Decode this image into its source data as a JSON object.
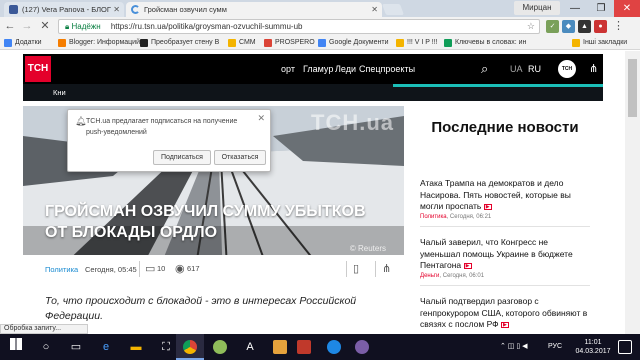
{
  "browser": {
    "tabs": [
      {
        "label": "(127) Vera Panova - БЛОГ",
        "favicon_color": "#3b5998"
      },
      {
        "label": "Гройсман озвучил сумм",
        "favicon_color": "#4a90d9"
      }
    ],
    "profile_name": "Мирцан",
    "window_controls": {
      "minimize": "—",
      "maximize": "❐",
      "close": "✕"
    },
    "omnibox": {
      "secure_label": "Надёжн",
      "url": "https://ru.tsn.ua/politika/groysman-ozvuchil-summu-ub"
    },
    "bookmarks": [
      {
        "label": "Додатки",
        "color": "#4285f4"
      },
      {
        "label": "Blogger: Информаций",
        "color": "#f57d00"
      },
      {
        "label": "Преобразует стену В",
        "color": "#222222"
      },
      {
        "label": "СММ",
        "color": "#f4b400"
      },
      {
        "label": "PROSPERO",
        "color": "#db4437"
      },
      {
        "label": "Google Документи",
        "color": "#4285f4"
      },
      {
        "label": "!!! V I P !!!",
        "color": "#f4b400"
      },
      {
        "label": "Ключевы в словах: ин",
        "color": "#0f9d58"
      },
      {
        "label": "Інші закладки",
        "color": "#f4b400"
      }
    ],
    "status_text": "Обробка запиту..."
  },
  "site": {
    "logo": "ТСН",
    "nav": [
      "орт",
      "Гламур",
      "Леди",
      "Спецпроекты"
    ],
    "langs": [
      "UA",
      "RU"
    ],
    "plus_logo": "ТСН",
    "subbar_label": "Кни"
  },
  "notification_popup": {
    "message": "TCH.ua предлагает подписаться на получение push-уведомлений",
    "subscribe_label": "Подписаться",
    "decline_label": "Отказаться"
  },
  "article": {
    "watermark": "ТСН.ua",
    "headline": "ГРОЙСМАН ОЗВУЧИЛ СУММУ УБЫТКОВ ОТ БЛОКАДЫ ОРДЛО",
    "photo_credit": "© Reuters",
    "category": "Политика",
    "time": "Сегодня, 05:45",
    "comments": "10",
    "views": "617",
    "lead": "То, что происходит с блокадой - это в интересах Российской Федерации."
  },
  "sidebar": {
    "title": "Последние новости",
    "items": [
      {
        "title": "Атака Трампа на демократов и дело Насирова. Пять новостей, которые вы могли проспать",
        "category": "Политика",
        "time": "Сегодня, 06:21"
      },
      {
        "title": "Чалый заверил, что Конгресс не уменьшал помощь Украине в бюджете Пентагона",
        "category": "Деньги",
        "time": "Сегодня, 06:01"
      },
      {
        "title": "Чалый подтвердил разговор с генпрокурором США, которого обвиняют в связях с послом РФ",
        "category": "",
        "time": ""
      }
    ]
  },
  "taskbar": {
    "lang": "РУС",
    "time": "11:01",
    "date": "04.03.2017"
  }
}
